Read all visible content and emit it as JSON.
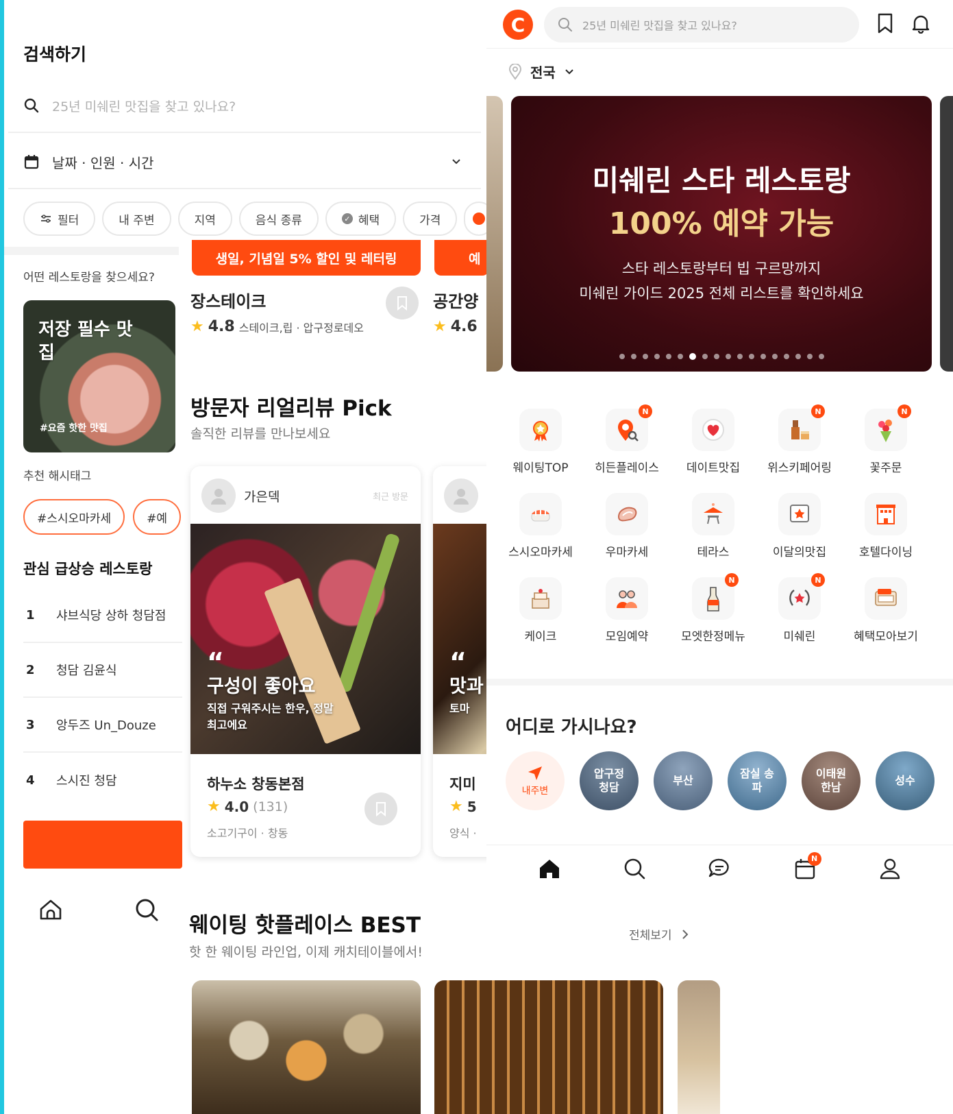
{
  "search_screen": {
    "title": "검색하기",
    "search_placeholder": "25년 미쉐린 맛집을 찾고 있나요?",
    "date_selector": "날짜 · 인원 · 시간",
    "filters": [
      "필터",
      "내 주변",
      "지역",
      "음식 종류",
      "혜택",
      "가격"
    ],
    "question": "어떤 레스토랑을 찾으세요?",
    "feature_card": {
      "title": "저장 필수 맛집",
      "tag": "#요즘 핫한 맛집"
    },
    "hashtag_label": "추천 해시태그",
    "hashtags": [
      "#스시오마카세",
      "#예"
    ],
    "rising_title": "관심 급상승 레스토랑",
    "rising": [
      {
        "rank": "1",
        "name": "샤브식당 상하 청담점"
      },
      {
        "rank": "2",
        "name": "청담 김윤식"
      },
      {
        "rank": "3",
        "name": "앙두즈 Un_Douze"
      },
      {
        "rank": "4",
        "name": "스시진 청담"
      }
    ]
  },
  "feed": {
    "promo_banner": "생일, 기념일 5% 할인 및 레터링",
    "promo_banner_2": "예",
    "restaurant_1": {
      "name": "장스테이크",
      "rating": "4.8",
      "meta": "스테이크,립 · 압구정로데오"
    },
    "restaurant_2": {
      "name": "공간양",
      "rating": "4.6"
    },
    "review_section": {
      "title": "방문자 리얼리뷰 Pick",
      "subtitle": "솔직한 리뷰를 만나보세요"
    },
    "review_card_1": {
      "reviewer": "가은덱",
      "time": "최근 방문",
      "quote_mark": "“",
      "quote_title": "구성이 좋아요",
      "quote_body": "직접 구워주시는 한우, 정말 최고에요",
      "restaurant": "하누소 창동본점",
      "rating": "4.0",
      "count": "(131)",
      "category": "소고기구이 · 창동"
    },
    "review_card_2": {
      "quote_mark": "“",
      "quote_title": "맛과",
      "quote_body": "토마",
      "restaurant": "지미",
      "rating": "5",
      "category": "양식 ·"
    },
    "best_section": {
      "title": "웨이팅 핫플레이스 BEST",
      "subtitle": "핫 한 웨이팅 라인업, 이제 캐치테이블에서!",
      "see_all": "전체보기"
    }
  },
  "home": {
    "logo_letter": "C",
    "search_placeholder": "25년 미쉐린 맛집을 찾고 있나요?",
    "location": "전국",
    "hero": {
      "title": "미쉐린 스타 레스토랑",
      "highlight": "100% 예약 가능",
      "subtitle_1": "스타 레스토랑부터 빕 구르망까지",
      "subtitle_2": "미쉐린 가이드 2025 전체 리스트를 확인하세요",
      "dot_count": 18,
      "active_dot": 6
    },
    "categories": [
      {
        "label": "웨이팅TOP",
        "icon": "medal-icon",
        "new": false
      },
      {
        "label": "히든플레이스",
        "icon": "map-pin-search-icon",
        "new": true
      },
      {
        "label": "데이트맛집",
        "icon": "heart-icon",
        "new": false
      },
      {
        "label": "위스키페어링",
        "icon": "whiskey-icon",
        "new": true
      },
      {
        "label": "꽃주문",
        "icon": "flower-bouquet-icon",
        "new": true
      },
      {
        "label": "스시오마카세",
        "icon": "sushi-icon",
        "new": false
      },
      {
        "label": "우마카세",
        "icon": "steak-icon",
        "new": false
      },
      {
        "label": "테라스",
        "icon": "terrace-table-icon",
        "new": false
      },
      {
        "label": "이달의맛집",
        "icon": "monthly-star-icon",
        "new": false
      },
      {
        "label": "호텔다이닝",
        "icon": "hotel-icon",
        "new": false
      },
      {
        "label": "케이크",
        "icon": "cake-icon",
        "new": false
      },
      {
        "label": "모임예약",
        "icon": "group-icon",
        "new": false
      },
      {
        "label": "모엣한정메뉴",
        "icon": "champagne-icon",
        "new": true
      },
      {
        "label": "미쉐린",
        "icon": "laurel-icon",
        "new": true
      },
      {
        "label": "혜택모아보기",
        "icon": "coupon-icon",
        "new": false
      }
    ],
    "new_badge": "N",
    "where_title": "어디로 가시나요?",
    "regions": [
      {
        "label": "내주변"
      },
      {
        "label": "압구정 청담"
      },
      {
        "label": "부산"
      },
      {
        "label": "잠실 송파"
      },
      {
        "label": "이태원 한남"
      },
      {
        "label": "성수"
      }
    ],
    "bottom_nav": [
      "home-icon",
      "search-icon",
      "chat-icon",
      "calendar-icon",
      "profile-icon"
    ],
    "colors": {
      "brand": "#ff4b10",
      "hero_bg": "#3c0a10",
      "hero_highlight": "#f3d28b"
    }
  }
}
